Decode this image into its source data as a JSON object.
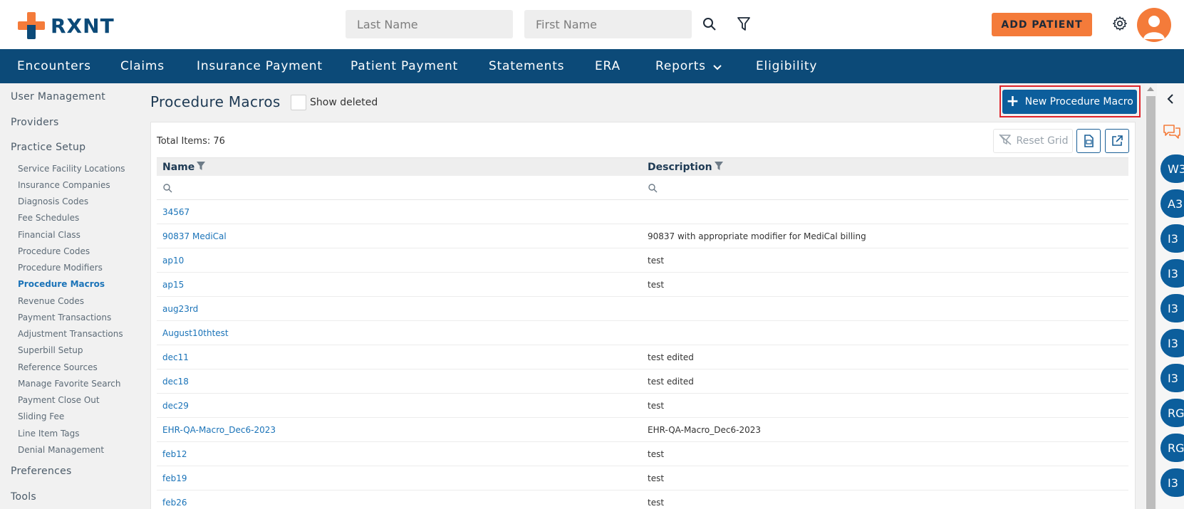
{
  "header": {
    "logo_text": "RXNT",
    "search_last_placeholder": "Last Name",
    "search_first_placeholder": "First Name",
    "add_patient_label": "ADD PATIENT",
    "brand_orange": "#f47b3a",
    "brand_navy": "#0c4a78"
  },
  "nav": {
    "items": [
      "Encounters",
      "Claims",
      "Insurance Payment",
      "Patient Payment",
      "Statements",
      "ERA",
      "Reports",
      "Eligibility"
    ]
  },
  "sidebar": {
    "sections": [
      "User Management",
      "Providers",
      "Practice Setup",
      "Preferences",
      "Tools"
    ],
    "practice_setup_items": [
      "Service Facility Locations",
      "Insurance Companies",
      "Diagnosis Codes",
      "Fee Schedules",
      "Financial Class",
      "Procedure Codes",
      "Procedure Modifiers",
      "Procedure Macros",
      "Revenue Codes",
      "Payment Transactions",
      "Adjustment Transactions",
      "Superbill Setup",
      "Reference Sources",
      "Manage Favorite Search",
      "Payment Close Out",
      "Sliding Fee",
      "Line Item Tags",
      "Denial Management"
    ],
    "active_item": "Procedure Macros"
  },
  "main": {
    "title": "Procedure Macros",
    "show_deleted_label": "Show deleted",
    "new_button_label": "New Procedure Macro",
    "total_items": "Total Items: 76",
    "reset_grid_label": "Reset Grid",
    "columns": [
      "Name",
      "Description"
    ],
    "rows": [
      {
        "name": "34567",
        "description": ""
      },
      {
        "name": "90837 MediCal",
        "description": "90837 with appropriate modifier for MediCal billing"
      },
      {
        "name": "ap10",
        "description": "test"
      },
      {
        "name": "ap15",
        "description": "test"
      },
      {
        "name": "aug23rd",
        "description": ""
      },
      {
        "name": "August10thtest",
        "description": ""
      },
      {
        "name": "dec11",
        "description": "test edited"
      },
      {
        "name": "dec18",
        "description": "test edited"
      },
      {
        "name": "dec29",
        "description": "test"
      },
      {
        "name": "EHR-QA-Macro_Dec6-2023",
        "description": "EHR-QA-Macro_Dec6-2023"
      },
      {
        "name": "feb12",
        "description": "test"
      },
      {
        "name": "feb19",
        "description": "test"
      },
      {
        "name": "feb26",
        "description": "test"
      }
    ]
  },
  "right_rail": {
    "avatars": [
      "W3",
      "A3",
      "I3",
      "I3",
      "I3",
      "I3",
      "I3",
      "RG",
      "RG",
      "I3"
    ]
  }
}
